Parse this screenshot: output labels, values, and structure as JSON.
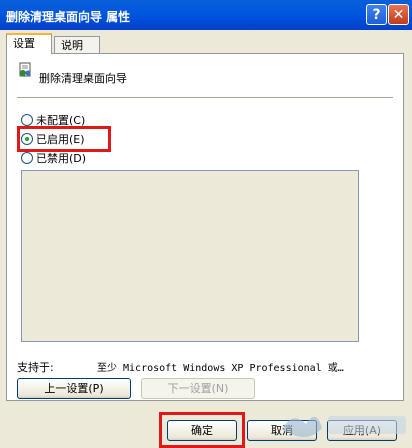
{
  "window": {
    "title": "删除清理桌面向导 属性",
    "help_label": "?",
    "close_label": "✕"
  },
  "tabs": [
    {
      "label": "设置",
      "active": true
    },
    {
      "label": "说明",
      "active": false
    }
  ],
  "setting": {
    "name": "删除清理桌面向导",
    "icon": "policy-icon"
  },
  "radios": [
    {
      "label": "未配置(C)",
      "checked": false
    },
    {
      "label": "已启用(E)",
      "checked": true
    },
    {
      "label": "已禁用(D)",
      "checked": false
    }
  ],
  "supported": {
    "label": "支持于:",
    "value": "至少 Microsoft Windows XP Professional 或…"
  },
  "nav_buttons": {
    "prev": "上一设置(P)",
    "next": "下一设置(N)"
  },
  "dialog_buttons": {
    "ok": "确定",
    "cancel": "取消",
    "apply": "应用(A)"
  },
  "colors": {
    "title_bar": "#0054e3",
    "highlight_box": "#e01818",
    "radio_dot": "#21a121"
  }
}
